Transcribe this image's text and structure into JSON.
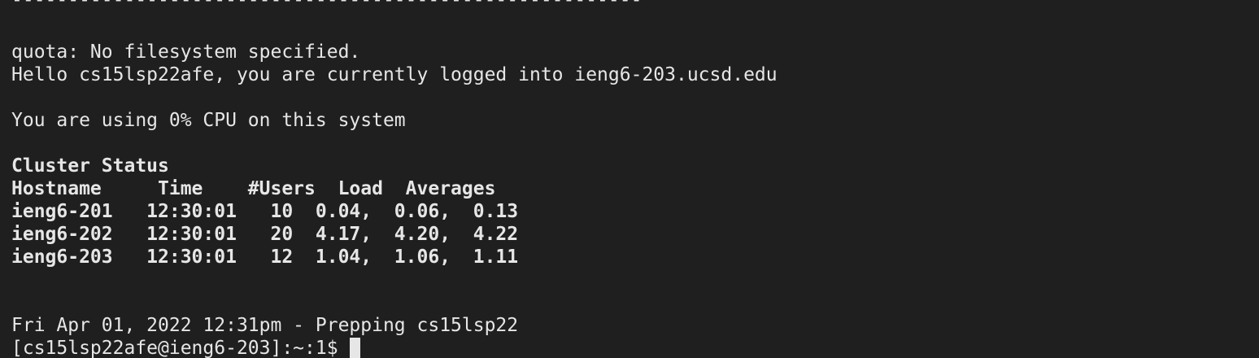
{
  "terminal": {
    "separator": "--------------------------------------------------------",
    "quota_message": "quota: No filesystem specified.",
    "greeting": "Hello cs15lsp22afe, you are currently logged into ieng6-203.ucsd.edu",
    "cpu_message": "You are using 0% CPU on this system",
    "cluster_title": "Cluster Status",
    "cluster_header": "Hostname     Time    #Users  Load  Averages",
    "cluster_rows": [
      "ieng6-201   12:30:01   10  0.04,  0.06,  0.13",
      "ieng6-202   12:30:01   20  4.17,  4.20,  4.22",
      "ieng6-203   12:30:01   12  1.04,  1.06,  1.11"
    ],
    "timestamp_message": "Fri Apr 01, 2022 12:31pm - Prepping cs15lsp22",
    "prompt": "[cs15lsp22afe@ieng6-203]:~:1$ "
  },
  "colors": {
    "background": "#1f1f1f",
    "foreground": "#e6e6e6"
  }
}
